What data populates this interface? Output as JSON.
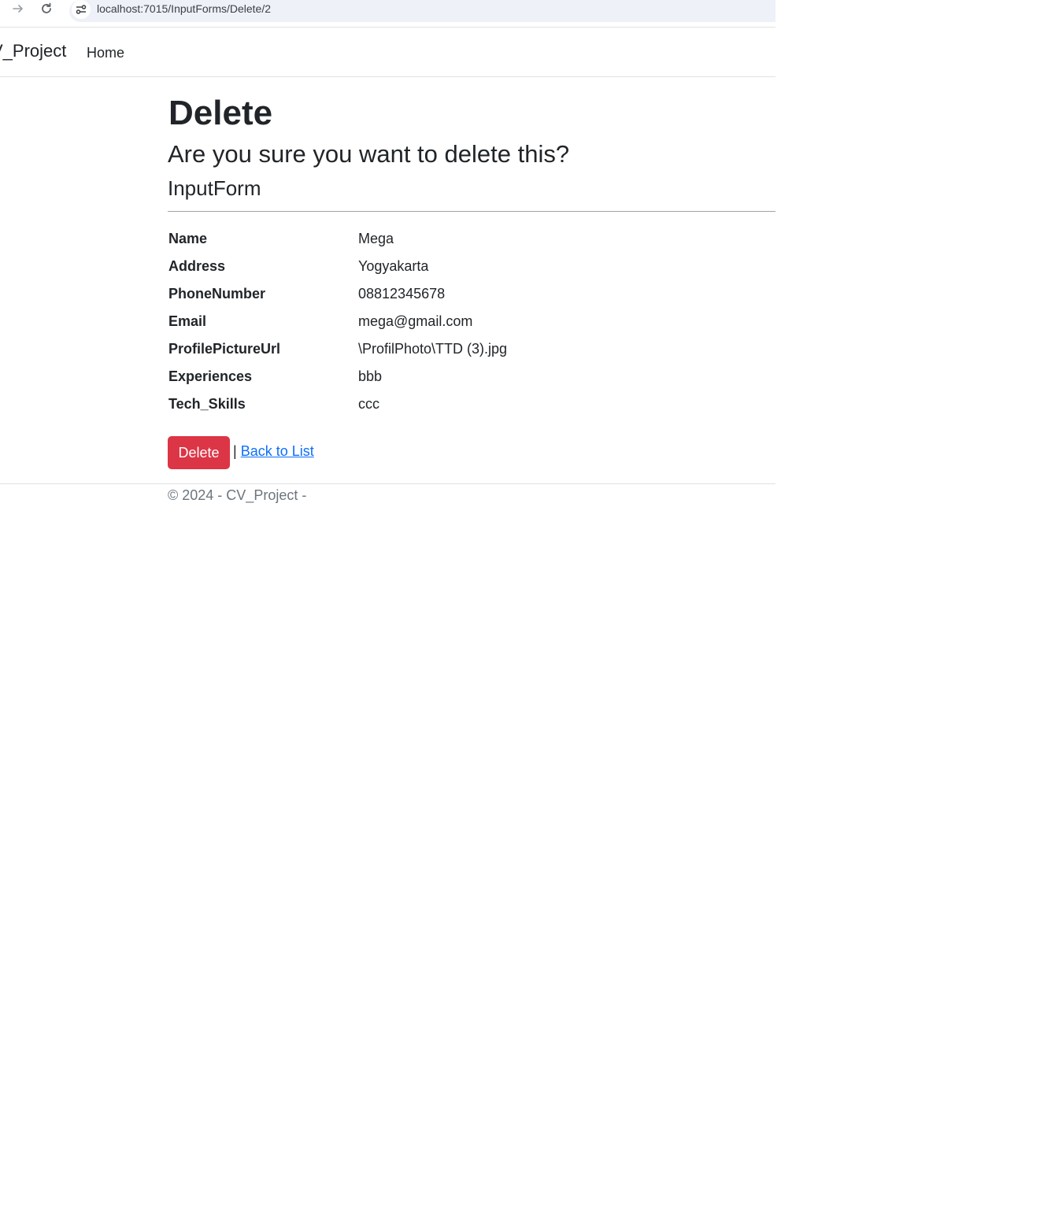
{
  "browser": {
    "url": "localhost:7015/InputForms/Delete/2"
  },
  "navbar": {
    "brand": "V_Project",
    "links": [
      "Home"
    ]
  },
  "page": {
    "title": "Delete",
    "confirm_text": "Are you sure you want to delete this?",
    "entity_name": "InputForm"
  },
  "details": [
    {
      "label": "Name",
      "value": "Mega"
    },
    {
      "label": "Address",
      "value": "Yogyakarta"
    },
    {
      "label": "PhoneNumber",
      "value": "08812345678"
    },
    {
      "label": "Email",
      "value": "mega@gmail.com"
    },
    {
      "label": "ProfilePictureUrl",
      "value": "\\ProfilPhoto\\TTD (3).jpg"
    },
    {
      "label": "Experiences",
      "value": "bbb"
    },
    {
      "label": "Tech_Skills",
      "value": "ccc"
    }
  ],
  "actions": {
    "delete_label": "Delete",
    "separator": "|",
    "back_label": "Back to List"
  },
  "footer": {
    "text": "© 2024 - CV_Project -"
  },
  "colors": {
    "danger": "#dc3545",
    "link": "#0d6efd",
    "muted": "#6c757d"
  }
}
